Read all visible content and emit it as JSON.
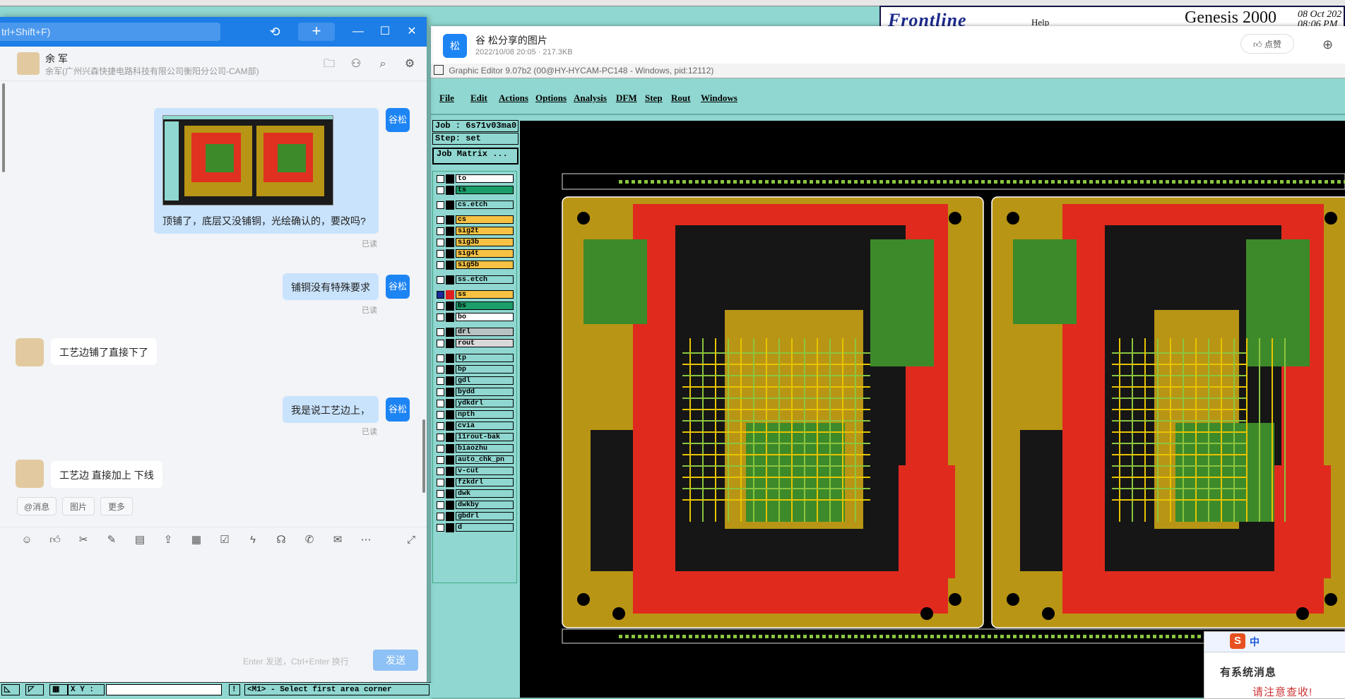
{
  "genesis": {
    "brand": "Frontline",
    "title": "Genesis 2000",
    "date_line1": "08 Oct 202",
    "date_line2": "08:06 PM",
    "help": "Help"
  },
  "viewer": {
    "avatar": "松",
    "title": "谷 松分享的图片",
    "meta": "2022/10/08 20:05 · 217.3KB",
    "like_label": "点赞"
  },
  "graphic_editor": {
    "window_title": "Graphic Editor 9.07b2 (00@HY-HYCAM-PC148 - Windows, pid:12112)",
    "menus": [
      "File",
      "Edit",
      "Actions",
      "Options",
      "Analysis",
      "DFM",
      "Step",
      "Rout",
      "Windows"
    ],
    "job": "Job : 6s71v03ma0",
    "step": "Step: set",
    "job_matrix": "Job Matrix ...",
    "layers": [
      {
        "name": "to",
        "color": "#ffffff"
      },
      {
        "name": "ts",
        "color": "#1c9e6a"
      },
      {
        "name": "cs.etch",
        "color": "#8fd7d0"
      },
      {
        "name": "cs",
        "color": "#f7c244"
      },
      {
        "name": "sig2t",
        "color": "#f7c244"
      },
      {
        "name": "sig3b",
        "color": "#f7c244"
      },
      {
        "name": "sig4t",
        "color": "#f7c244"
      },
      {
        "name": "sig5b",
        "color": "#f7c244"
      },
      {
        "name": "ss.etch",
        "color": "#8fd7d0"
      },
      {
        "name": "ss",
        "color": "#f7c244"
      },
      {
        "name": "bs",
        "color": "#1c9e6a"
      },
      {
        "name": "bo",
        "color": "#ffffff"
      },
      {
        "name": "drl",
        "color": "#b8c2c2"
      },
      {
        "name": "rout",
        "color": "#d8d8d8"
      },
      {
        "name": "tp",
        "color": "#8fd7d0"
      },
      {
        "name": "bp",
        "color": "#8fd7d0"
      },
      {
        "name": "gdl",
        "color": "#8fd7d0"
      },
      {
        "name": "bydd",
        "color": "#8fd7d0"
      },
      {
        "name": "ydkdrl",
        "color": "#8fd7d0"
      },
      {
        "name": "npth",
        "color": "#8fd7d0"
      },
      {
        "name": "cvia",
        "color": "#8fd7d0"
      },
      {
        "name": "11rout-bak",
        "color": "#8fd7d0"
      },
      {
        "name": "biaozhu",
        "color": "#8fd7d0"
      },
      {
        "name": "auto_chk_pn",
        "color": "#8fd7d0"
      },
      {
        "name": "v-cut",
        "color": "#8fd7d0"
      },
      {
        "name": "fzkdrl",
        "color": "#8fd7d0"
      },
      {
        "name": "dwk",
        "color": "#8fd7d0"
      },
      {
        "name": "dwkby",
        "color": "#8fd7d0"
      },
      {
        "name": "gbdrl",
        "color": "#8fd7d0"
      },
      {
        "name": "d",
        "color": "#8fd7d0"
      }
    ]
  },
  "chat": {
    "search_placeholder": "trl+Shift+F)",
    "contact_name": "余 军",
    "contact_org": "余军(广州兴森快捷电路科技有限公司衡阳分公司-CAM部)",
    "me_avatar": "谷松",
    "messages": [
      {
        "from": "me",
        "text": "顶铺了，底层又没铺铜，光绘确认的，要改吗?",
        "status": "已读"
      },
      {
        "from": "me",
        "text": "铺铜没有特殊要求",
        "status": "已读"
      },
      {
        "from": "other",
        "text": "工艺边铺了直接下了"
      },
      {
        "from": "me",
        "text": "我是说工艺边上，",
        "status": "已读"
      },
      {
        "from": "other",
        "text": "工艺边 直接加上 下线"
      }
    ],
    "quick": [
      "@消息",
      "图片",
      "更多"
    ],
    "send_hint": "Enter 发送，Ctrl+Enter 换行",
    "send_label": "发送"
  },
  "statusbar": {
    "coord_label": "X Y :",
    "prompt": "<M1> - Select first area corner"
  },
  "notification": {
    "ime_lang": "中",
    "title": "有系统消息",
    "body": "请注意查收!"
  }
}
